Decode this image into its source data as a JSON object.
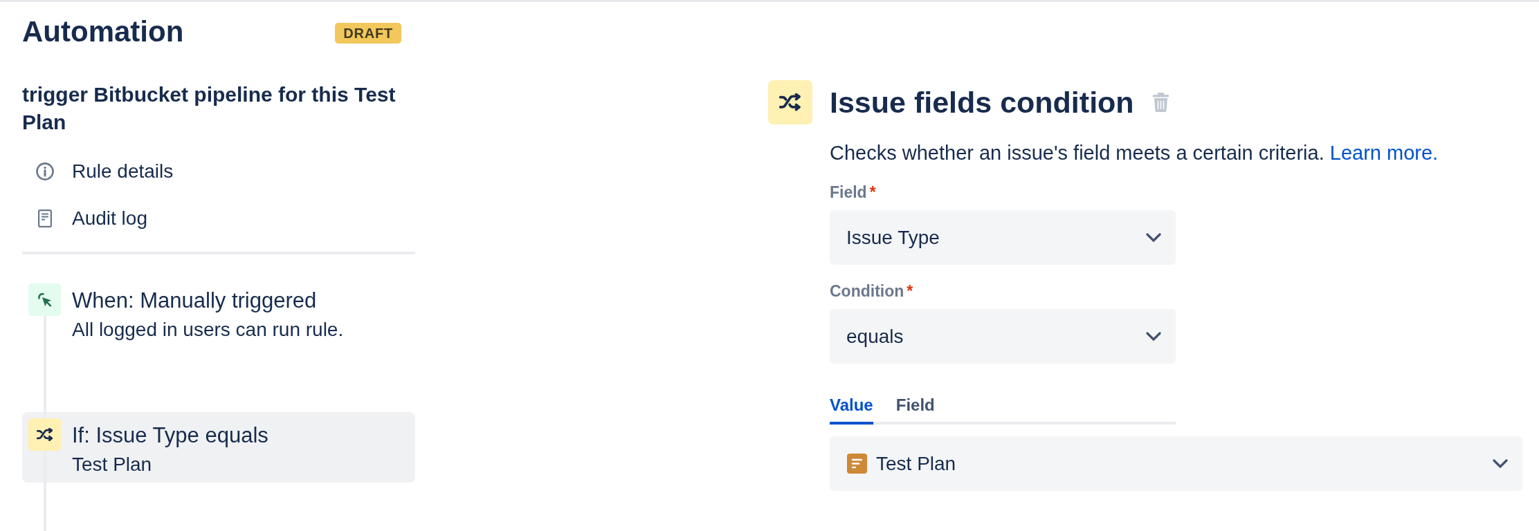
{
  "header": {
    "title": "Automation",
    "badge": "DRAFT"
  },
  "rule": {
    "name": "trigger Bitbucket pipeline for this Test Plan"
  },
  "nav_items": [
    {
      "kind": "details",
      "label": "Rule details"
    },
    {
      "kind": "audit",
      "label": "Audit log"
    }
  ],
  "steps": [
    {
      "kind": "trigger",
      "title": "When: Manually triggered",
      "detail": "All logged in users can run rule.",
      "selected": false
    },
    {
      "kind": "condition",
      "title": "If: Issue Type equals",
      "detail": "Test Plan",
      "selected": true
    }
  ],
  "editor": {
    "title": "Issue fields condition",
    "description": "Checks whether an issue's field meets a certain criteria.",
    "link": "Learn more.",
    "fields": [
      {
        "label": "Field",
        "required_mark": "*",
        "value": "Issue Type"
      },
      {
        "label": "Condition",
        "required_mark": "*",
        "value": "equals"
      }
    ],
    "value_tabs": [
      {
        "label": "Value",
        "selected": true
      },
      {
        "label": "Field",
        "selected": false
      }
    ],
    "value_select": {
      "value": "Test Plan"
    }
  }
}
